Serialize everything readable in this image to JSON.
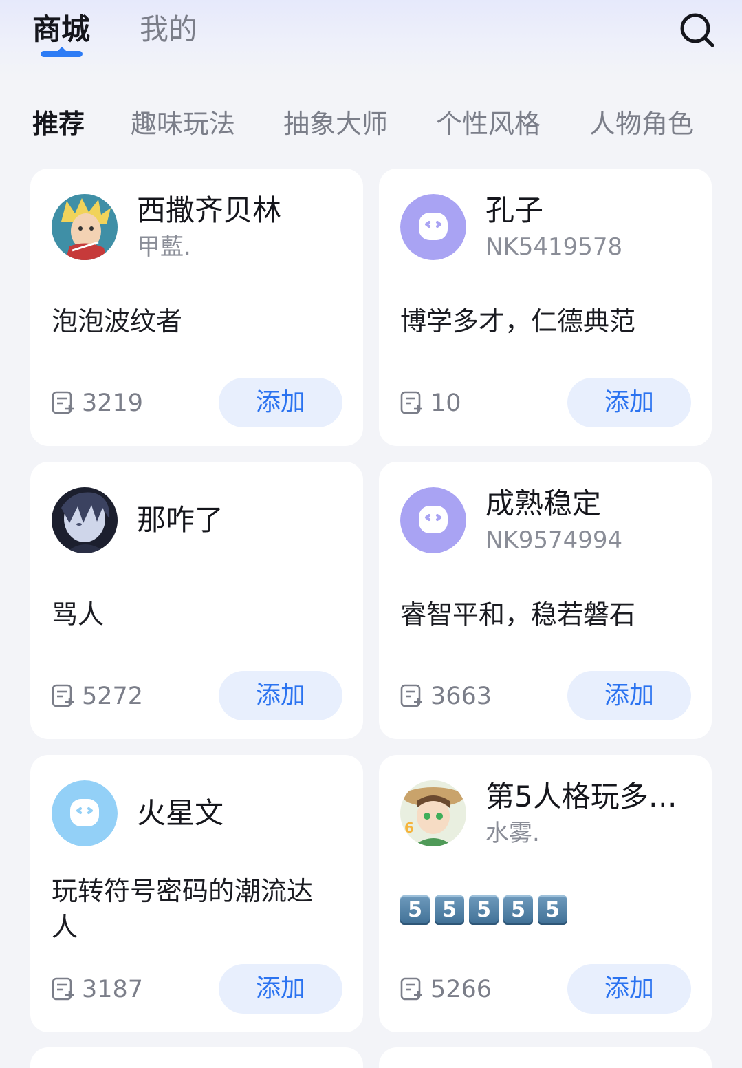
{
  "top_tabs": [
    {
      "label": "商城",
      "active": true
    },
    {
      "label": "我的",
      "active": false
    }
  ],
  "search": {
    "icon": "search-icon"
  },
  "categories": [
    "推荐",
    "趣味玩法",
    "抽象大师",
    "个性风格",
    "人物角色"
  ],
  "add_label": "添加",
  "cards": [
    {
      "name": "西撒齐贝林",
      "author": "甲藍.",
      "description": "泡泡波纹者",
      "count": "3219",
      "avatar": "anime-portrait"
    },
    {
      "name": "孔子",
      "author": "NK5419578",
      "description": "博学多才，仁德典范",
      "count": "10",
      "avatar": "default-bot-purple"
    },
    {
      "name": "那咋了",
      "author": "",
      "description": "骂人",
      "count": "5272",
      "avatar": "anime-portrait-dark"
    },
    {
      "name": "成熟稳定",
      "author": "NK9574994",
      "description": "睿智平和，稳若磐石",
      "count": "3663",
      "avatar": "default-bot-purple"
    },
    {
      "name": "火星文",
      "author": "",
      "description": "玩转符号密码的潮流达人",
      "count": "3187",
      "avatar": "default-bot-blue"
    },
    {
      "name": "第5人格玩多…",
      "author": "水雾.",
      "description": "",
      "keycaps": [
        "5",
        "5",
        "5",
        "5",
        "5"
      ],
      "count": "5266",
      "avatar": "cartoon-girl"
    }
  ],
  "colors": {
    "accent": "#2d7cf5",
    "button_bg": "#e8effd",
    "button_text": "#2b73f0",
    "bot_purple": "#a9a3f3",
    "bot_blue": "#93d0f7"
  }
}
